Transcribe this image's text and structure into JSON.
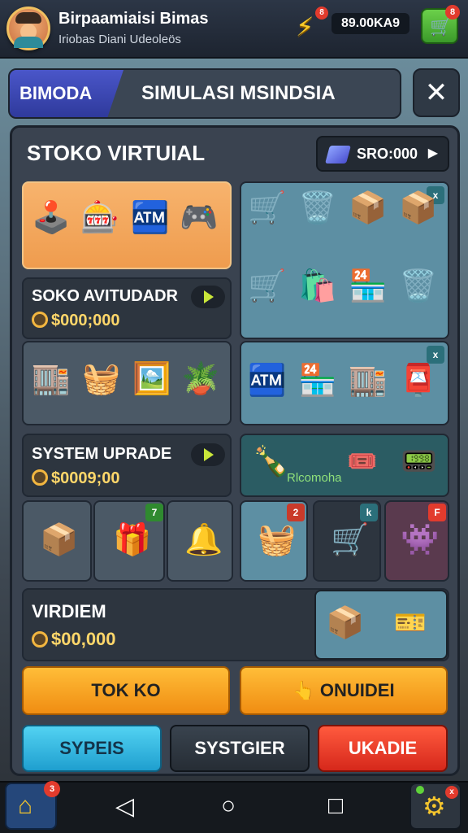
{
  "header": {
    "title": "Birpaamiaisi Bimas",
    "subtitle": "Iriobas Diani Udeoleös",
    "energy_badge": "8",
    "currency": "89.00KA9",
    "cart_badge": "8"
  },
  "banner": {
    "tag": "BIMODA",
    "title": "SIMULASI MSINDSIA"
  },
  "panel": {
    "title": "STOKO VIRTUIAL",
    "money": "SRO:000"
  },
  "sections": {
    "stock": {
      "title": "SOKO AVITUDADR",
      "price": "$000;000"
    },
    "system": {
      "title": "SYSTEM UPRADE",
      "price": "$0009;00"
    },
    "viridiem": {
      "title": "VIRDIEM",
      "price": "$00,000"
    },
    "promo_label": "Rlcomoha"
  },
  "badges": {
    "grid1_top": "x",
    "grid2_top": "x",
    "box_mid": "7",
    "basket": "2",
    "cart_k": "k",
    "arcade_f": "F"
  },
  "buttons": {
    "tokko": "TOK KO",
    "onlidei": "ONUIDEI",
    "synteis": "SYPEIS",
    "systeier": "SYSTGIER",
    "ukadie": "UKADIE"
  },
  "nav": {
    "home_badge": "3",
    "gear_badge": "x"
  }
}
